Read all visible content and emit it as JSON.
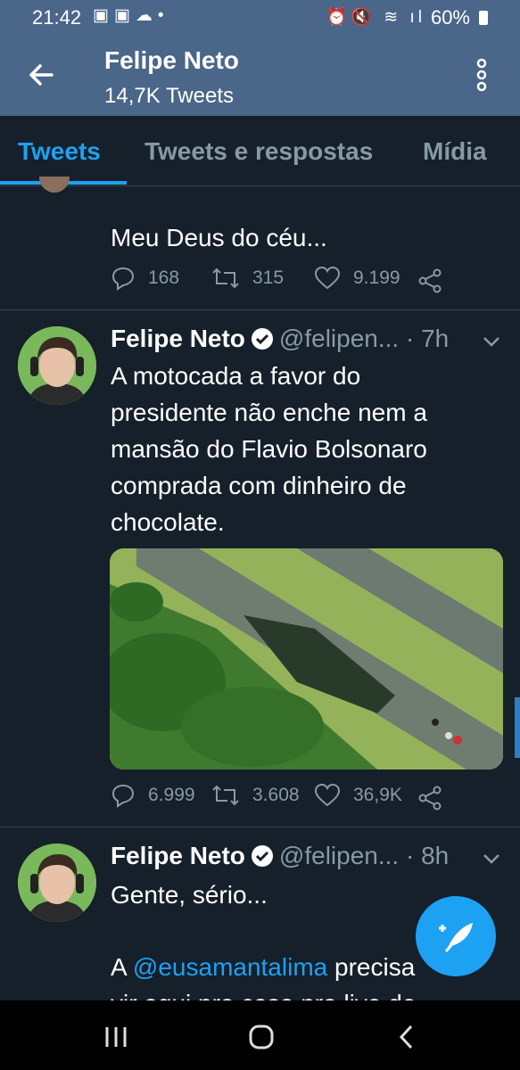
{
  "status_bar": {
    "time": "21:42",
    "battery": "60%"
  },
  "header": {
    "title": "Felipe Neto",
    "subtitle": "14,7K Tweets"
  },
  "tabs": [
    {
      "label": "Tweets",
      "active": true
    },
    {
      "label": "Tweets e respostas",
      "active": false
    },
    {
      "label": "Mídia",
      "active": false
    }
  ],
  "tweets": [
    {
      "text": "Meu Deus do céu...",
      "replies": "168",
      "retweets": "315",
      "likes": "9.199"
    },
    {
      "name": "Felipe Neto",
      "handle": "@felipen...",
      "time": "· 7h",
      "text_lines": [
        "A motocada a favor do",
        "presidente não enche nem a",
        "mansão do Flavio Bolsonaro",
        "comprada com dinheiro de",
        "chocolate."
      ],
      "replies": "6.999",
      "retweets": "3.608",
      "likes": "36,9K"
    },
    {
      "name": "Felipe Neto",
      "handle": "@felipen...",
      "time": "· 8h",
      "line1": "Gente, sério...",
      "line2_prefix": "A ",
      "mention": "@eusamantalima",
      "line2_suffix": " precisa",
      "line3": "vir aqui pra casa pra live de"
    }
  ],
  "colors": {
    "background": "#15202b",
    "header": "#4a6689",
    "accent": "#1da1f2",
    "muted": "#8899a6"
  },
  "icons": [
    "back-arrow-icon",
    "more-vertical-icon",
    "reply-icon",
    "retweet-icon",
    "like-icon",
    "share-icon",
    "verified-icon",
    "chevron-down-icon",
    "compose-icon"
  ]
}
